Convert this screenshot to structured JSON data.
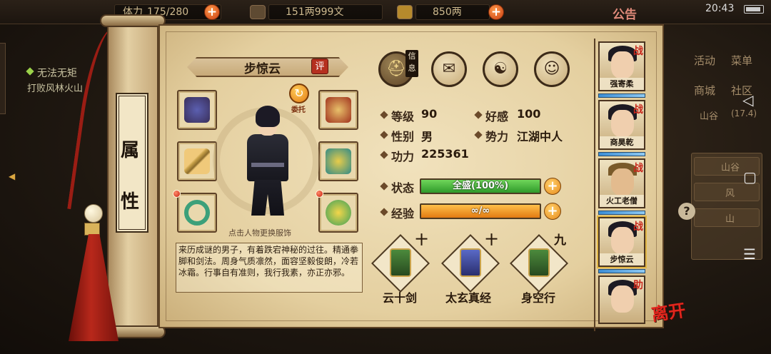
{
  "status_bar": {
    "stamina_label": "体力",
    "stamina": "175/280",
    "money": "151两999文",
    "gold": "850两",
    "notice": "公告",
    "time": "20:43"
  },
  "quest": {
    "title": "无法无矩",
    "desc": "打败风林火山"
  },
  "side_menu": {
    "items": [
      "活动",
      "菜单",
      "商城",
      "社区"
    ],
    "area_label": "山谷",
    "area_level": "(17.4)",
    "list": [
      "山谷",
      "风",
      "山"
    ]
  },
  "scroll": {
    "title_char_1": "属",
    "title_char_2": "性"
  },
  "character": {
    "name": "步惊云",
    "review_badge": "评",
    "entrust_label": "委托",
    "hint": "点击人物更换服饰",
    "description": "来历成谜的男子，有着跌宕神秘的过往。精通拳脚和剑法。周身气质凛然，面容坚毅俊朗，冷若冰霜。行事自有准则，我行我素，亦正亦邪。"
  },
  "tabs": {
    "info_label": "信息",
    "items": [
      "info-tab",
      "bag-tab",
      "taiji-tab",
      "meridian-tab"
    ]
  },
  "stats": {
    "level_label": "等级",
    "level": "90",
    "favor_label": "好感",
    "favor": "100",
    "gender_label": "性别",
    "gender": "男",
    "faction_label": "势力",
    "faction": "江湖中人",
    "power_label": "功力",
    "power": "225361"
  },
  "bars": {
    "status_label": "状态",
    "status_text": "全盛(100%)",
    "status_fill": 100,
    "exp_label": "经验",
    "exp_text": "∞/∞",
    "exp_fill": 100
  },
  "skills": [
    {
      "name": "云十剑",
      "level": "十"
    },
    {
      "name": "太玄真经",
      "level": "十"
    },
    {
      "name": "身空行",
      "level": "九"
    }
  ],
  "roster": [
    {
      "name": "强寄柔",
      "tag": "战"
    },
    {
      "name": "商昊乾",
      "tag": "战"
    },
    {
      "name": "火工老僧",
      "tag": "战"
    },
    {
      "name": "步惊云",
      "tag": "战"
    },
    {
      "name": "",
      "tag": "助"
    }
  ],
  "leave_label": "离开",
  "colors": {
    "status_bar": "#3fb53a",
    "exp_bar": "#f08c1c",
    "accent_red": "#c8271b"
  }
}
